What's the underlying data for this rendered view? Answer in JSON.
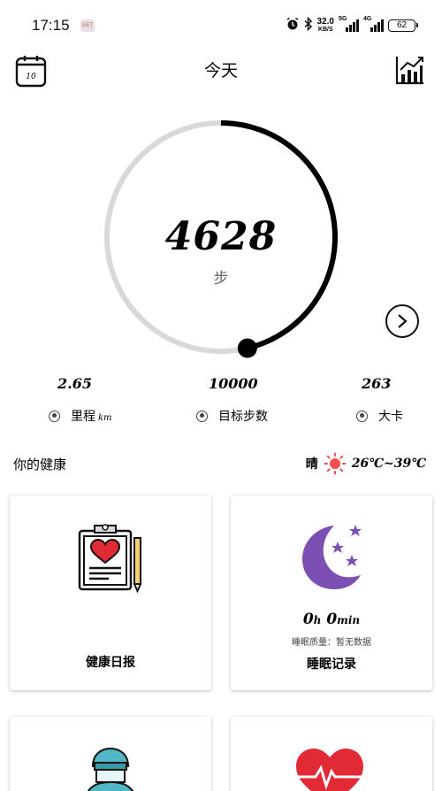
{
  "status_bar": {
    "time": "17:15",
    "app_badge": "GET",
    "net_speed_value": "32.0",
    "net_speed_unit": "KB/S",
    "signal_1_label": "5G",
    "signal_2_label": "4G",
    "battery": "62"
  },
  "header": {
    "calendar_day": "10",
    "title": "今天"
  },
  "steps": {
    "value": "4628",
    "unit": "步",
    "goal_progress": 0.4628
  },
  "stats": [
    {
      "value": "2.65",
      "label": "里程",
      "unit": "km"
    },
    {
      "value": "10000",
      "label": "目标步数"
    },
    {
      "value": "263",
      "label": "大卡"
    }
  ],
  "health": {
    "title": "你的健康",
    "weather_label": "晴",
    "weather_icon": "sun-icon",
    "temperature": "26℃~39℃"
  },
  "cards": {
    "daily_report": {
      "label": "健康日报",
      "icon": "clipboard-heart-icon"
    },
    "sleep": {
      "hours": "0",
      "hours_unit": "h",
      "minutes": "0",
      "minutes_unit": "min",
      "quality": "睡眠质量：暂无数据",
      "label": "睡眠记录",
      "icon": "moon-stars-icon"
    },
    "card3_icon": "doctor-icon",
    "card4_icon": "heart-rate-icon"
  },
  "colors": {
    "ring_track": "#d9d9d9",
    "ring_progress": "#000000",
    "moon": "#7b4fb3",
    "heart": "#e12a35",
    "sun": "#f04e4e"
  }
}
